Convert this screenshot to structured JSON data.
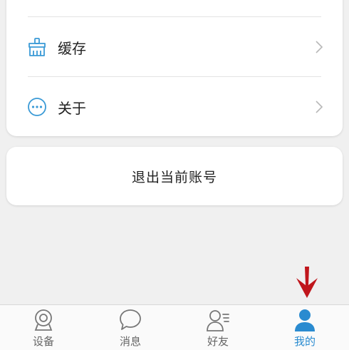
{
  "settings": {
    "items": [
      {
        "label": "缓存",
        "icon": "broom-icon"
      },
      {
        "label": "关于",
        "icon": "more-circle-icon"
      }
    ]
  },
  "logout": {
    "label": "退出当前账号"
  },
  "tabbar": {
    "tabs": [
      {
        "label": "设备",
        "icon": "camera-icon",
        "active": false
      },
      {
        "label": "消息",
        "icon": "chat-bubble-icon",
        "active": false
      },
      {
        "label": "好友",
        "icon": "friends-icon",
        "active": false
      },
      {
        "label": "我的",
        "icon": "person-icon",
        "active": true
      }
    ]
  },
  "colors": {
    "accent": "#2a8bd0",
    "annotation": "#c0161c"
  }
}
